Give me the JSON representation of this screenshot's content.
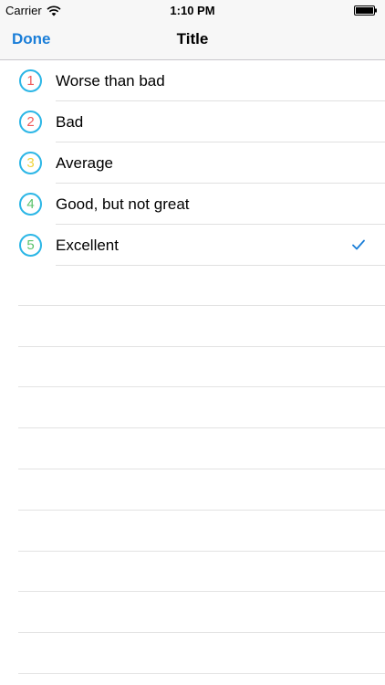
{
  "status_bar": {
    "carrier": "Carrier",
    "time": "1:10 PM",
    "icons": [
      "wifi-icon",
      "battery-icon"
    ]
  },
  "nav": {
    "done_label": "Done",
    "title": "Title"
  },
  "ratings": [
    {
      "number": "1",
      "label": "Worse than bad",
      "number_color": "#f05a5a",
      "selected": false
    },
    {
      "number": "2",
      "label": "Bad",
      "number_color": "#f05a5a",
      "selected": false
    },
    {
      "number": "3",
      "label": "Average",
      "number_color": "#f0d43c",
      "selected": false
    },
    {
      "number": "4",
      "label": "Good, but not great",
      "number_color": "#59c26a",
      "selected": false
    },
    {
      "number": "5",
      "label": "Excellent",
      "number_color": "#59c26a",
      "selected": true
    }
  ],
  "colors": {
    "accent": "#1a7ed8",
    "badge_ring": "#2bb6e6"
  }
}
